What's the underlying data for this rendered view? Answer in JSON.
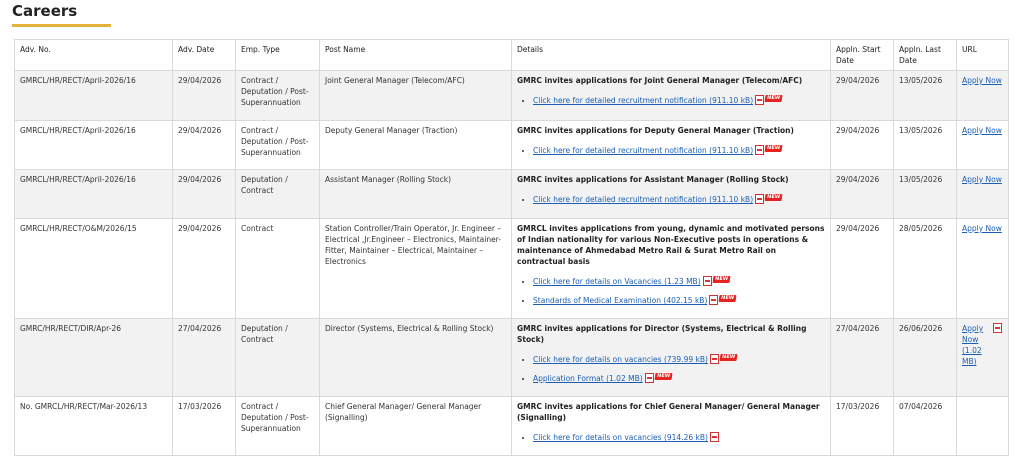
{
  "page": {
    "title": "Careers"
  },
  "table": {
    "headers": [
      "Adv. No.",
      "Adv. Date",
      "Emp. Type",
      "Post Name",
      "Details",
      "Appln. Start Date",
      "Appln. Last Date",
      "URL"
    ],
    "rows": [
      {
        "adv_no": "GMRCL/HR/RECT/April-2026/16",
        "adv_date": "29/04/2026",
        "emp_type": "Contract / Deputation / Post-Superannuation",
        "post_name": "Joint General Manager (Telecom/AFC)",
        "details_title": "GMRC invites applications for Joint General Manager (Telecom/AFC)",
        "links": [
          {
            "text": "Click here for detailed recruitment notification (911.10 kB)",
            "new": true,
            "new_label": "NEW"
          }
        ],
        "start": "29/04/2026",
        "last": "13/05/2026",
        "url": "Apply Now"
      },
      {
        "adv_no": "GMRCL/HR/RECT/April-2026/16",
        "adv_date": "29/04/2026",
        "emp_type": "Contract / Deputation / Post-Superannuation",
        "post_name": "Deputy General Manager (Traction)",
        "details_title": "GMRC invites applications for Deputy General Manager (Traction)",
        "links": [
          {
            "text": "Click here for detailed recruitment notification (911.10 kB)",
            "new": true,
            "new_label": "NEW"
          }
        ],
        "start": "29/04/2026",
        "last": "13/05/2026",
        "url": "Apply Now"
      },
      {
        "adv_no": "GMRCL/HR/RECT/April-2026/16",
        "adv_date": "29/04/2026",
        "emp_type": "Deputation / Contract",
        "post_name": "Assistant Manager (Rolling Stock)",
        "details_title": "GMRC invites applications for Assistant Manager (Rolling Stock)",
        "links": [
          {
            "text": "Click here for detailed recruitment notification (911.10 kB)",
            "new": true,
            "new_label": "NEW"
          }
        ],
        "start": "29/04/2026",
        "last": "13/05/2026",
        "url": "Apply Now"
      },
      {
        "adv_no": "GMRCL/HR/RECT/O&M/2026/15",
        "adv_date": "29/04/2026",
        "emp_type": "Contract",
        "post_name": "Station Controller/Train Operator, Jr. Engineer – Electrical ,Jr.Engineer – Electronics, Maintainer- Fitter, Maintainer – Electrical, Maintainer – Electronics",
        "details_title": "GMRCL invites applications from young, dynamic and motivated persons of Indian nationality for various Non-Executive posts in operations & maintenance of Ahmedabad Metro Rail & Surat Metro Rail on contractual basis",
        "links": [
          {
            "text": "Click here for details on Vacancies (1.23 MB)",
            "new": true,
            "new_label": "NEW"
          },
          {
            "text": "Standards of Medical Examination (402.15 kB)",
            "new": true,
            "new_label": "NEW"
          }
        ],
        "start": "29/04/2026",
        "last": "28/05/2026",
        "url": "Apply Now"
      },
      {
        "adv_no": "GMRC/HR/RECT/DIR/Apr-26",
        "adv_date": "27/04/2026",
        "emp_type": "Deputation / Contract",
        "post_name": "Director (Systems, Electrical & Rolling Stock)",
        "details_title": "GMRC invites applications for Director (Systems, Electrical & Rolling Stock)",
        "links": [
          {
            "text": "Click here for details on vacancies (739.99 kB)",
            "new": true,
            "new_label": "NEW"
          },
          {
            "text": "Application Format (1.02 MB)",
            "new": true,
            "new_label": "NEW"
          }
        ],
        "start": "27/04/2026",
        "last": "26/06/2026",
        "url": "Apply Now (1.02 MB)"
      },
      {
        "adv_no": "No. GMRCL/HR/RECT/Mar-2026/13",
        "adv_date": "17/03/2026",
        "emp_type": "Contract / Deputation / Post-Superannuation",
        "post_name": "Chief General Manager/ General Manager (Signalling)",
        "details_title": "GMRC invites applications for Chief General Manager/ General Manager (Signalling)",
        "links": [
          {
            "text": "Click here for details on vacancies (914.26 kB)",
            "new": false
          }
        ],
        "start": "17/03/2026",
        "last": "07/04/2026",
        "url": ""
      }
    ]
  }
}
